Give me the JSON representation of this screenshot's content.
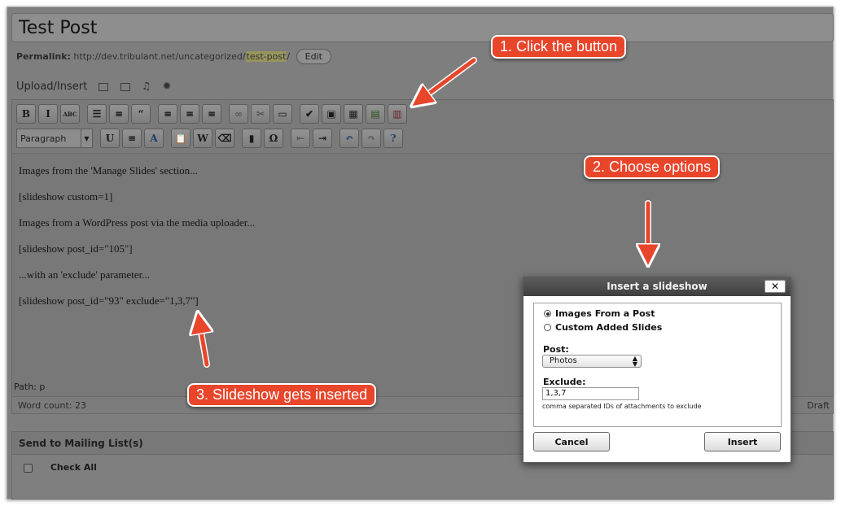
{
  "post": {
    "title": "Test Post",
    "permalink_label": "Permalink:",
    "permalink_base": " http://dev.tribulant.net/uncategorized/",
    "permalink_slug": "test-post",
    "permalink_trail": "/",
    "edit_label": "Edit"
  },
  "upload": {
    "label": "Upload/Insert"
  },
  "toolbar": {
    "row1": [
      {
        "icon": "bold-icon",
        "glyph": "B"
      },
      {
        "icon": "italic-icon",
        "glyph": "I"
      },
      {
        "icon": "strikethrough-icon",
        "glyph": "ABC"
      },
      {
        "icon": "unordered-list-icon",
        "glyph": "☰"
      },
      {
        "icon": "ordered-list-icon",
        "glyph": "≡"
      },
      {
        "icon": "blockquote-icon",
        "glyph": "“"
      },
      {
        "icon": "align-left-icon",
        "glyph": "≡"
      },
      {
        "icon": "align-center-icon",
        "glyph": "≡"
      },
      {
        "icon": "align-right-icon",
        "glyph": "≡"
      },
      {
        "icon": "link-icon",
        "glyph": "∞"
      },
      {
        "icon": "unlink-icon",
        "glyph": "✂"
      },
      {
        "icon": "more-tag-icon",
        "glyph": "▭"
      },
      {
        "icon": "spellcheck-icon",
        "glyph": "✔"
      },
      {
        "icon": "fullscreen-icon",
        "glyph": "▣"
      },
      {
        "icon": "kitchen-sink-icon",
        "glyph": "▦"
      },
      {
        "icon": "insert-slideshow-icon",
        "glyph": "▤"
      },
      {
        "icon": "remove-slideshow-icon",
        "glyph": "▥"
      }
    ],
    "paragraph_label": "Paragraph",
    "row2": [
      {
        "icon": "underline-icon",
        "glyph": "U"
      },
      {
        "icon": "justify-icon",
        "glyph": "≡"
      },
      {
        "icon": "text-color-icon",
        "glyph": "A"
      },
      {
        "icon": "paste-text-icon",
        "glyph": "📋"
      },
      {
        "icon": "paste-word-icon",
        "glyph": "W"
      },
      {
        "icon": "clear-formatting-icon",
        "glyph": "⌫"
      },
      {
        "icon": "media-icon",
        "glyph": "▮"
      },
      {
        "icon": "special-char-icon",
        "glyph": "Ω"
      },
      {
        "icon": "outdent-icon",
        "glyph": "⇤"
      },
      {
        "icon": "indent-icon",
        "glyph": "⇥"
      },
      {
        "icon": "undo-icon",
        "glyph": "↶"
      },
      {
        "icon": "redo-icon",
        "glyph": "↷"
      },
      {
        "icon": "help-icon",
        "glyph": "?"
      }
    ]
  },
  "content": [
    "Images from the 'Manage Slides' section...",
    "[slideshow custom=1]",
    "Images from a WordPress post via the media uploader...",
    "[slideshow post_id=\"105\"]",
    "...with an 'exclude' parameter...",
    "[slideshow post_id=\"93\" exclude=\"1,3,7\"]"
  ],
  "status": {
    "path": "Path: p",
    "word_count": "Word count: 23",
    "draft": "Draft"
  },
  "mailing": {
    "title": "Send to Mailing List(s)",
    "check_all": "Check All"
  },
  "callouts": {
    "c1": "1. Click the button",
    "c2": "2. Choose options",
    "c3": "3. Slideshow gets inserted"
  },
  "dialog": {
    "title": "Insert a slideshow",
    "close": "✕",
    "radio1": "Images From a Post",
    "radio2": "Custom Added Slides",
    "post_label": "Post:",
    "post_value": "Photos",
    "exclude_label": "Exclude:",
    "exclude_value": "1,3,7",
    "hint": "comma separated IDs of attachments to exclude",
    "cancel": "Cancel",
    "insert": "Insert"
  },
  "colors": {
    "callout": "#e8452b",
    "overlay": "#7e7e7e"
  }
}
